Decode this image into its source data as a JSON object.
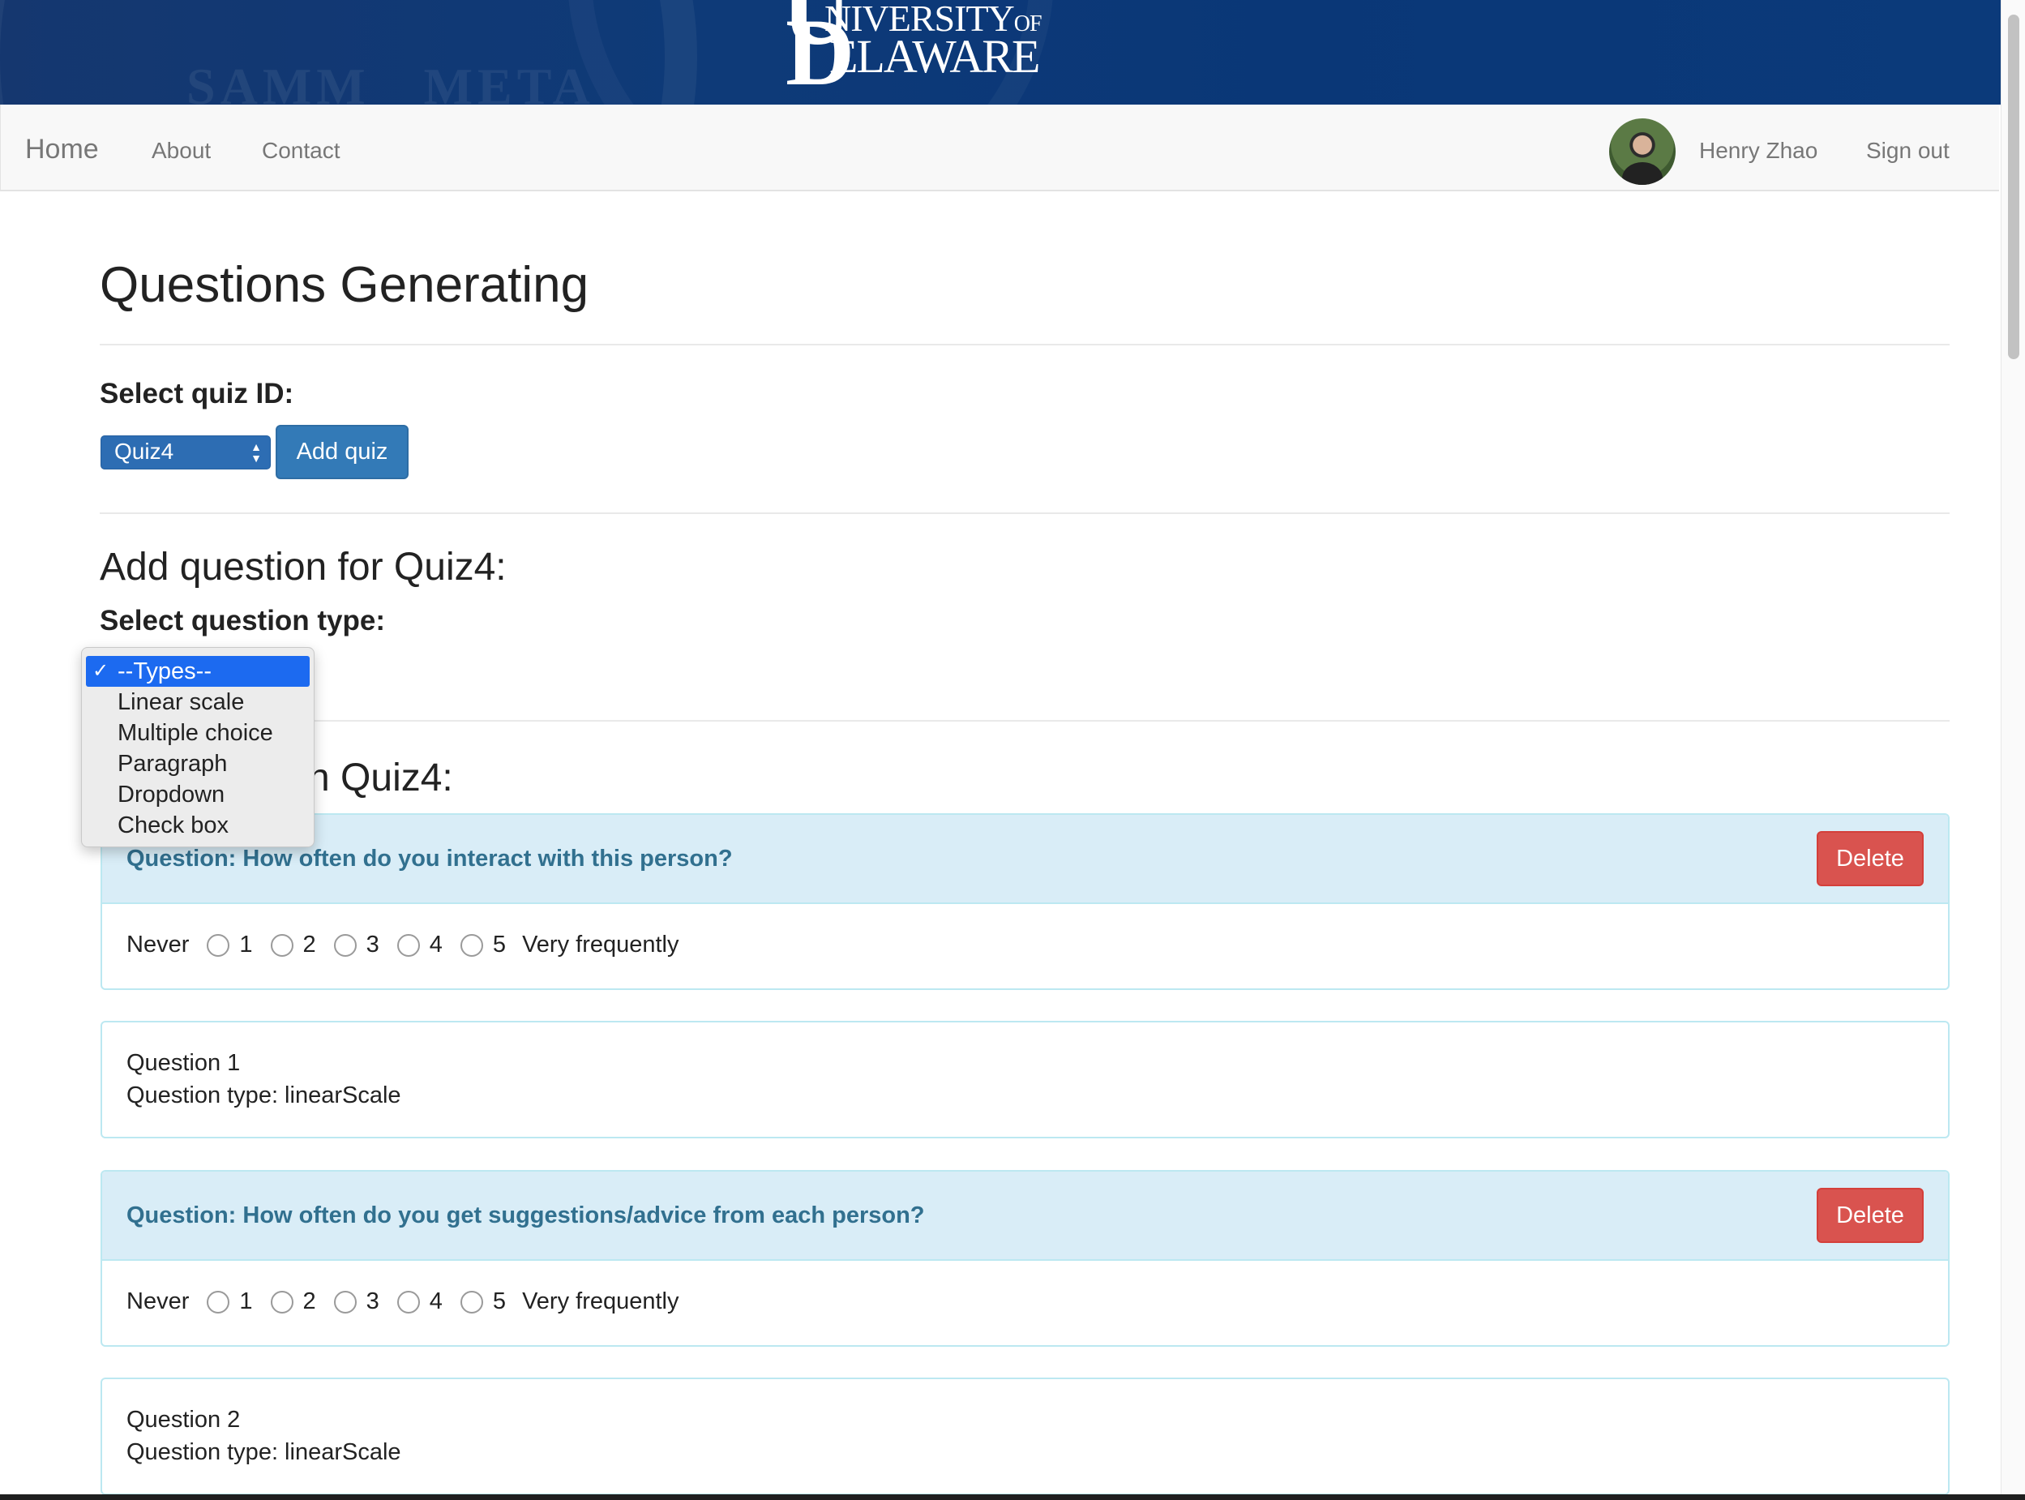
{
  "brand": {
    "logo_top": "NIVERSITY",
    "logo_of": "OF",
    "logo_bottom": "ELAWARE",
    "logo_u": "U",
    "logo_d": "D",
    "logo_full": "UNIVERSITY OF DELAWARE"
  },
  "navbar": {
    "home": "Home",
    "about": "About",
    "contact": "Contact",
    "user_name": "Henry Zhao",
    "sign_out": "Sign out"
  },
  "page": {
    "title": "Questions Generating",
    "select_quiz_label": "Select quiz ID:",
    "quiz_select_value": "Quiz4",
    "add_quiz_button": "Add quiz",
    "add_question_heading": "Add question for Quiz4:",
    "select_type_label": "Select question type:",
    "questions_heading_tail": "n Quiz4:"
  },
  "type_dropdown": {
    "selected": "--Types--",
    "options": [
      "Linear scale",
      "Multiple choice",
      "Paragraph",
      "Dropdown",
      "Check box"
    ]
  },
  "questions": [
    {
      "heading": "Question: How often do you interact with this person?",
      "delete_label": "Delete",
      "scale_low": "Never",
      "scale_high": "Very frequently",
      "scale_points": [
        "1",
        "2",
        "3",
        "4",
        "5"
      ],
      "info_number": "Question 1",
      "info_type": "Question type: linearScale"
    },
    {
      "heading": "Question: How often do you get suggestions/advice from each person?",
      "delete_label": "Delete",
      "scale_low": "Never",
      "scale_high": "Very frequently",
      "scale_points": [
        "1",
        "2",
        "3",
        "4",
        "5"
      ],
      "info_number": "Question 2",
      "info_type": "Question type: linearScale"
    }
  ],
  "colors": {
    "banner": "#0a3777",
    "primary": "#337ab7",
    "danger": "#d9534f",
    "panel_heading": "#d9edf7",
    "panel_text": "#31708f",
    "dropdown_highlight": "#1c6af0"
  }
}
